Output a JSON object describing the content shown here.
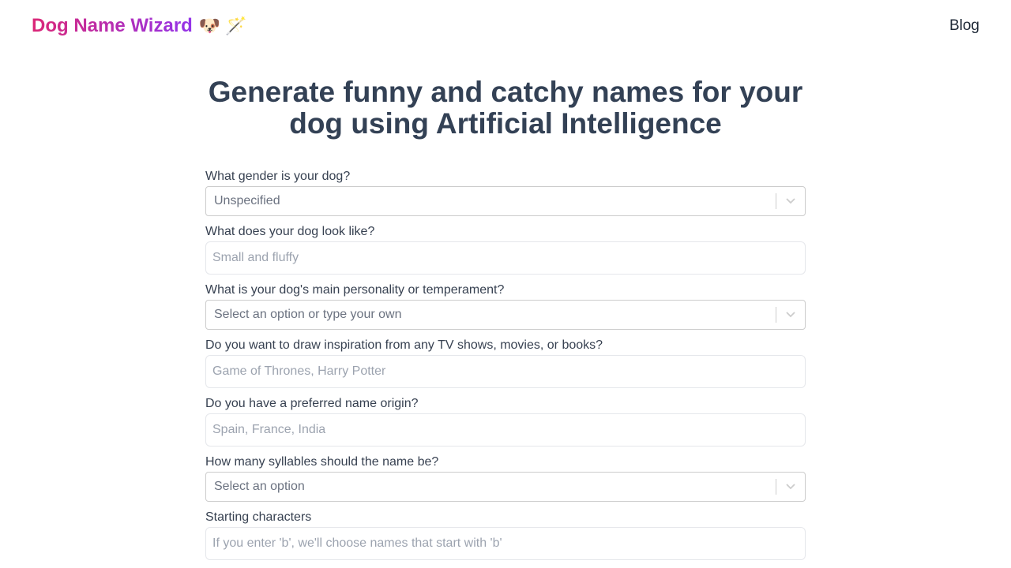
{
  "header": {
    "logo_text": "Dog Name Wizard",
    "logo_emoji": "🐶 🪄",
    "blog_label": "Blog"
  },
  "headline": "Generate funny and catchy names for your dog using Artificial Intelligence",
  "form": {
    "gender": {
      "label": "What gender is your dog?",
      "value": "Unspecified"
    },
    "look": {
      "label": "What does your dog look like?",
      "placeholder": "Small and fluffy"
    },
    "personality": {
      "label": "What is your dog's main personality or temperament?",
      "value": "Select an option or type your own"
    },
    "inspiration": {
      "label": "Do you want to draw inspiration from any TV shows, movies, or books?",
      "placeholder": "Game of Thrones, Harry Potter"
    },
    "origin": {
      "label": "Do you have a preferred name origin?",
      "placeholder": "Spain, France, India"
    },
    "syllables": {
      "label": "How many syllables should the name be?",
      "value": "Select an option"
    },
    "starting": {
      "label": "Starting characters",
      "placeholder": "If you enter 'b', we'll choose names that start with 'b'"
    }
  },
  "colors": {
    "logo_gradient_start": "#db2777",
    "logo_gradient_end": "#9333ea",
    "heading": "#334155"
  },
  "icons": {
    "dropdown": "chevron-down-icon"
  }
}
